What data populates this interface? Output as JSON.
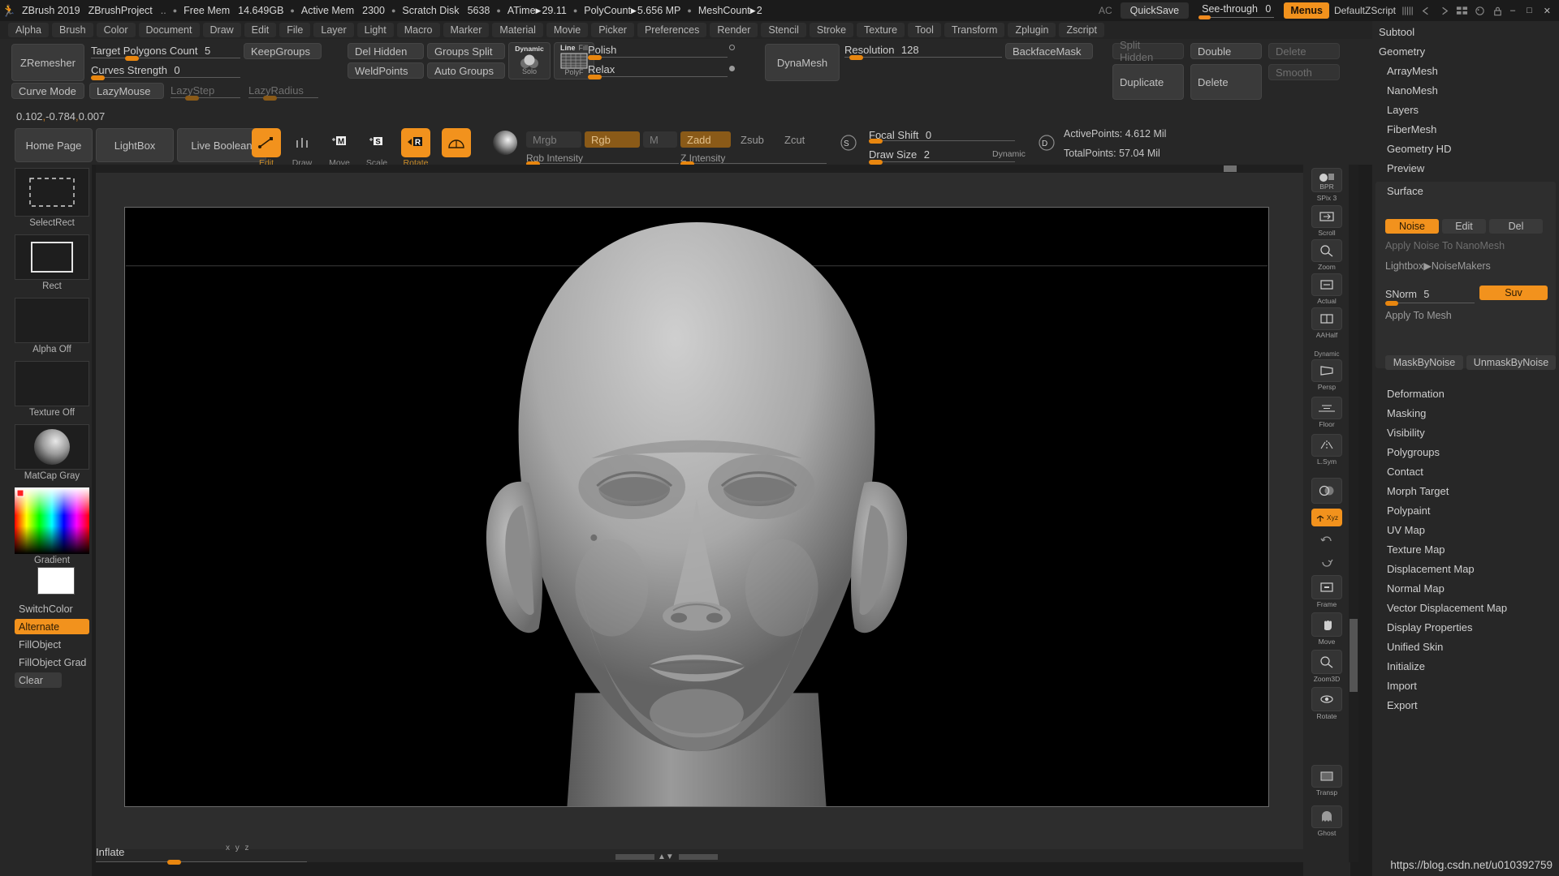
{
  "titlebar": {
    "app_icon": "runner-icon",
    "app_name": "ZBrush 2019",
    "project": "ZBrushProject",
    "dots": "..",
    "stats": [
      {
        "label": "Free Mem",
        "value": "14.649GB"
      },
      {
        "label": "Active Mem",
        "value": "2300"
      },
      {
        "label": "Scratch Disk",
        "value": "5638"
      },
      {
        "label": "ATime",
        "arrow": "▶",
        "value": "29.11"
      },
      {
        "label": "PolyCount",
        "arrow": "▶",
        "value": "5.656 MP"
      },
      {
        "label": "MeshCount",
        "arrow": "▶",
        "value": "2"
      }
    ],
    "ac": "AC",
    "quicksave": "QuickSave",
    "seethrough_label": "See-through",
    "seethrough_value": "0",
    "menus": "Menus",
    "default_zscript": "DefaultZScript",
    "window_minimize": "–",
    "window_maximize": "□",
    "window_close": "✕"
  },
  "menubar": {
    "items": [
      "Alpha",
      "Brush",
      "Color",
      "Document",
      "Draw",
      "Edit",
      "File",
      "Layer",
      "Light",
      "Macro",
      "Marker",
      "Material",
      "Movie",
      "Picker",
      "Preferences",
      "Render",
      "Stencil",
      "Stroke",
      "Texture",
      "Tool",
      "Transform",
      "Zplugin",
      "Zscript"
    ]
  },
  "shelf": {
    "zremesher": "ZRemesher",
    "target_polygons_label": "Target Polygons Count",
    "target_polygons_value": "5",
    "curves_strength_label": "Curves Strength",
    "curves_strength_value": "0",
    "keep_groups": "KeepGroups",
    "curve_mode": "Curve Mode",
    "lazy_mouse": "LazyMouse",
    "lazy_step": "LazyStep",
    "lazy_radius": "LazyRadius",
    "del_hidden": "Del Hidden",
    "weld_points": "WeldPoints",
    "groups_split": "Groups Split",
    "auto_groups": "Auto Groups",
    "dynamic": "Dynamic",
    "solo": "Solo",
    "line": "Line",
    "fill": "Fill",
    "polyf": "PolyF",
    "polish_label": "Polish",
    "relax_label": "Relax",
    "dynamesh": "DynaMesh",
    "resolution_label": "Resolution",
    "resolution_value": "128",
    "backface_mask": "BackfaceMask",
    "split_hidden": "Split Hidden",
    "double": "Double",
    "delete_top": "Delete",
    "duplicate": "Duplicate",
    "delete_btn": "Delete",
    "smooth": "Smooth",
    "coords": "0.102,-0.784,0.007",
    "coords_a": "0.102",
    "coords_b": "-0.784",
    "coords_c": "0.007",
    "home_page": "Home Page",
    "lightbox": "LightBox",
    "live_boolean": "Live Boolean",
    "tools": [
      {
        "name": "Edit",
        "icon": "edit-icon",
        "active": true
      },
      {
        "name": "Draw",
        "icon": "draw-icon",
        "active": false
      },
      {
        "name": "Move",
        "icon": "move-icon",
        "active": false
      },
      {
        "name": "Scale",
        "icon": "scale-icon",
        "active": false
      },
      {
        "name": "Rotate",
        "icon": "rotate-icon",
        "active": true
      }
    ],
    "sphere_icon": "material-sphere-icon",
    "mrgb": "Mrgb",
    "rgb": "Rgb",
    "m": "M",
    "zadd": "Zadd",
    "zsub": "Zsub",
    "zcut": "Zcut",
    "rgb_intensity_label": "Rgb Intensity",
    "z_intensity_label": "Z Intensity",
    "focal_shift_label": "Focal Shift",
    "focal_shift_value": "0",
    "draw_size_label": "Draw Size",
    "draw_size_value": "2",
    "dynamic_badge": "Dynamic",
    "active_points": "ActivePoints: 4.612 Mil",
    "total_points": "TotalPoints: 57.04 Mil",
    "s_badge": "S",
    "d_badge": "D"
  },
  "leftbar": {
    "tiles": [
      {
        "label": "SelectRect",
        "icon": "select-rect-icon"
      },
      {
        "label": "Rect",
        "icon": "rect-stroke-icon"
      },
      {
        "label": "Alpha Off",
        "icon": "alpha-off-icon"
      },
      {
        "label": "Texture Off",
        "icon": "texture-off-icon"
      },
      {
        "label": "MatCap Gray",
        "icon": "matcap-gray-icon"
      },
      {
        "label": "Gradient",
        "icon": "gradient-picker-icon"
      }
    ],
    "switch_color": "SwitchColor",
    "alternate": "Alternate",
    "fill_object": "FillObject",
    "fill_object_grad": "FillObject Grad",
    "clear": "Clear"
  },
  "canvas": {
    "inflate_label": "Inflate",
    "inflate_axes": "x y z",
    "model": "human-head-sculpt"
  },
  "rightstrip": {
    "items": [
      {
        "label": "BPR",
        "caption": "SPix 3",
        "icon": "bpr-render-icon",
        "active": false
      },
      {
        "label": "Scroll",
        "caption": "Scroll",
        "icon": "scroll-icon",
        "active": false
      },
      {
        "label": "Zoom",
        "caption": "Zoom",
        "icon": "zoom-icon",
        "active": false
      },
      {
        "label": "Actual",
        "caption": "Actual",
        "icon": "actual-size-icon",
        "active": false
      },
      {
        "label": "AAHalf",
        "caption": "AAHalf",
        "icon": "aahalf-icon",
        "active": false
      },
      {
        "label": "Persp",
        "caption": "Persp",
        "icon": "perspective-icon",
        "active": false,
        "badge": "Dynamic"
      },
      {
        "label": "Floor",
        "caption": "Floor",
        "icon": "floor-grid-icon",
        "active": false
      },
      {
        "label": "L.Sym",
        "caption": "L.Sym",
        "icon": "local-symmetry-icon",
        "active": false
      },
      {
        "label": "Transp",
        "caption": "",
        "icon": "transparency-icon",
        "active": false
      },
      {
        "label": "Xyz",
        "caption": "",
        "icon": "xyz-axis-icon",
        "active": true
      },
      {
        "label": "Frame",
        "caption": "Frame",
        "icon": "frame-icon",
        "active": false
      },
      {
        "label": "Move",
        "caption": "Move",
        "icon": "move-hand-icon",
        "active": false
      },
      {
        "label": "Zoom3D",
        "caption": "Zoom3D",
        "icon": "zoom3d-icon",
        "active": false
      },
      {
        "label": "Rotate",
        "caption": "Rotate",
        "icon": "rotate3d-icon",
        "active": false
      },
      {
        "label": "Transp",
        "caption": "Transp",
        "icon": "transp-icon",
        "active": false
      },
      {
        "label": "Ghost",
        "caption": "Ghost",
        "icon": "ghost-icon",
        "active": false
      }
    ]
  },
  "rightpanel": {
    "menu_items": [
      "Subtool",
      "Geometry",
      "ArrayMesh",
      "NanoMesh",
      "Layers",
      "FiberMesh",
      "Geometry HD",
      "Preview"
    ],
    "surface_title": "Surface",
    "noise": "Noise",
    "edit": "Edit",
    "del": "Del",
    "apply_noise_to_nanomesh": "Apply Noise To NanoMesh",
    "lightbox_noisemakers": "Lightbox▶NoiseMakers",
    "snorm_label": "SNorm",
    "snorm_value": "5",
    "suv": "Suv",
    "apply_to_mesh": "Apply To Mesh",
    "mask_by_noise": "MaskByNoise",
    "unmask_by_noise": "UnmaskByNoise",
    "menu_items_2": [
      "Deformation",
      "Masking",
      "Visibility",
      "Polygroups",
      "Contact",
      "Morph Target",
      "Polypaint",
      "UV Map",
      "Texture Map",
      "Displacement Map",
      "Normal Map",
      "Vector Displacement Map",
      "Display Properties",
      "Unified Skin",
      "Initialize",
      "Import",
      "Export"
    ]
  },
  "watermark": "https://blog.csdn.net/u010392759",
  "colors": {
    "accent": "#f2921d",
    "panel": "#272727",
    "titlebar": "#1b1b1b",
    "button": "#3a3a3a",
    "text": "#c8c8c8",
    "amber": "#8a5a18"
  }
}
